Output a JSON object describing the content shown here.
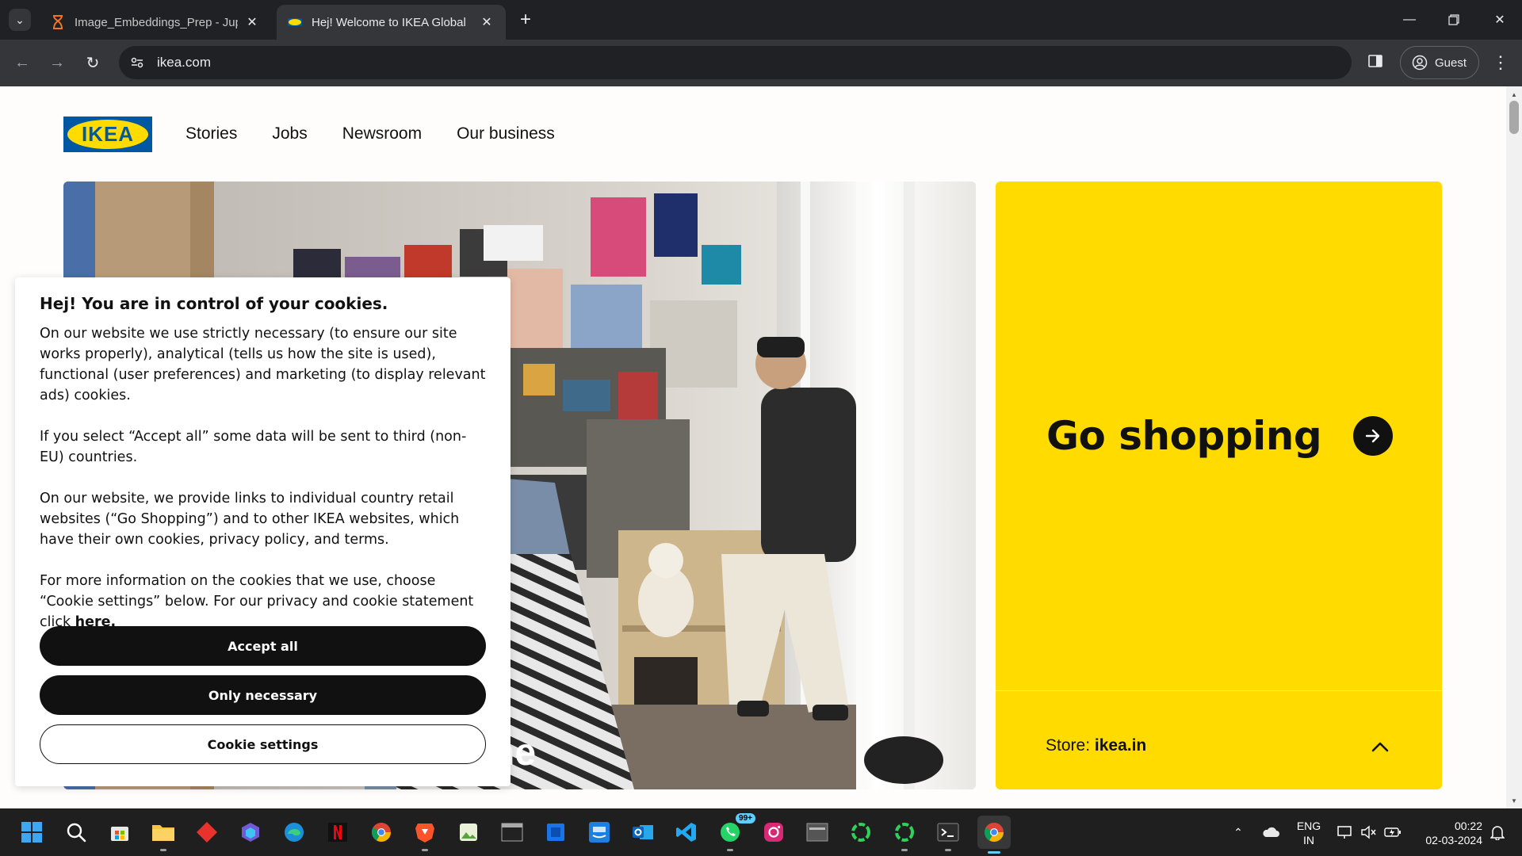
{
  "browser": {
    "tabs": [
      {
        "title": "Image_Embeddings_Prep - Jupy",
        "icon": "hourglass-icon",
        "active": false
      },
      {
        "title": "Hej! Welcome to IKEA Global",
        "icon": "ikea-favicon",
        "active": true
      }
    ],
    "new_tab_glyph": "+",
    "url": "ikea.com",
    "profile_label": "Guest"
  },
  "site": {
    "logo_text": "IKEA",
    "nav": [
      "Stories",
      "Jobs",
      "Newsroom",
      "Our business"
    ],
    "hero_partial_text": "ne",
    "shop": {
      "title": "Go shopping",
      "store_label": "Store:",
      "store_value": "ikea.in"
    }
  },
  "cookie_banner": {
    "heading": "Hej! You are in control of your cookies.",
    "p1": "On our website we use strictly necessary (to ensure our site works properly), analytical (tells us how the site is used), functional (user preferences) and marketing (to display relevant ads) cookies.",
    "p2": "If you select “Accept all” some data will be sent to third (non-EU) countries.",
    "p3": "On our website, we provide links to individual country retail websites (“Go Shopping”) and to other IKEA websites, which have their own cookies, privacy policy, and terms.",
    "p4": "For more information on the cookies that we use, choose “Cookie settings” below. For our privacy and cookie statement click ",
    "p4_link": "here.",
    "accept_all": "Accept all",
    "only_necessary": "Only necessary",
    "cookie_settings": "Cookie settings"
  },
  "taskbar": {
    "whatsapp_badge": "99+",
    "language": "ENG",
    "region": "IN",
    "time": "00:22",
    "date": "02-03-2024"
  },
  "colors": {
    "ikea_yellow": "#ffdb00",
    "ikea_blue": "#0058a3",
    "browser_dark": "#202124"
  }
}
